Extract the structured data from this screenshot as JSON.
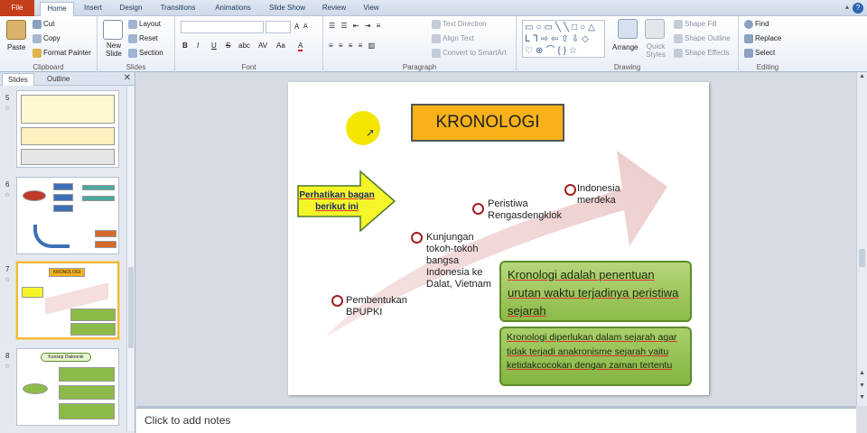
{
  "tabs": [
    "File",
    "Home",
    "Insert",
    "Design",
    "Transitions",
    "Animations",
    "Slide Show",
    "Review",
    "View"
  ],
  "active_tab": "Home",
  "ribbon": {
    "clipboard": {
      "label": "Clipboard",
      "paste": "Paste",
      "cut": "Cut",
      "copy": "Copy",
      "format_painter": "Format Painter"
    },
    "slides": {
      "label": "Slides",
      "new_slide": "New Slide",
      "layout": "Layout",
      "reset": "Reset",
      "section": "Section"
    },
    "font": {
      "label": "Font",
      "bold": "B",
      "italic": "I",
      "underline": "U",
      "strike": "S",
      "shadow": "abc",
      "spacing": "AV",
      "case": "Aa",
      "color": "A",
      "grow": "A",
      "shrink": "A"
    },
    "paragraph": {
      "label": "Paragraph",
      "text_direction": "Text Direction",
      "align_text": "Align Text",
      "convert_smartart": "Convert to SmartArt"
    },
    "drawing": {
      "label": "Drawing",
      "arrange": "Arrange",
      "quick_styles": "Quick Styles",
      "shape_fill": "Shape Fill",
      "shape_outline": "Shape Outline",
      "shape_effects": "Shape Effects"
    },
    "editing": {
      "label": "Editing",
      "find": "Find",
      "replace": "Replace",
      "select": "Select"
    }
  },
  "panel": {
    "tabs": [
      "Slides",
      "Outline"
    ],
    "active_tab": "Slides",
    "thumbnails": [
      {
        "number": "5"
      },
      {
        "number": "6"
      },
      {
        "number": "7",
        "title": "KRONOLOGI"
      },
      {
        "number": "8",
        "title": "Konsep Diakronik"
      }
    ],
    "selected": "7"
  },
  "slide": {
    "title": "KRONOLOGI",
    "callout": "Perhatikan bagan berikut ini",
    "events": [
      "Pembentukan BPUPKI",
      "Kunjungan tokoh-tokoh bangsa Indonesia ke Dalat, Vietnam",
      "Peristiwa Rengasdengklok",
      "Indonesia merdeka"
    ],
    "definition": "Kronologi adalah penentuan urutan waktu terjadinya peristiwa sejarah",
    "explanation": "Kronologi diperlukan dalam sejarah agar tidak terjadi anakronisme sejarah yaitu ketidakcocokan dengan zaman tertentu"
  },
  "notes_placeholder": "Click to add notes",
  "colors": {
    "file_tab": "#c43e1c",
    "title_fill": "#f7b21a",
    "callout_fill": "#f5f52a",
    "arrow": "#f2d3d3",
    "green_box": "#8cbb49",
    "highlight": "#f4e600"
  }
}
